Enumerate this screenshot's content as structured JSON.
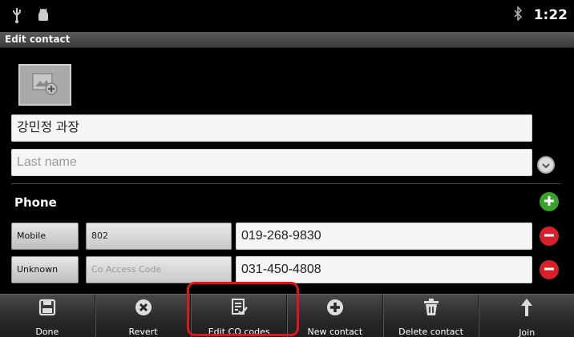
{
  "status_bar": {
    "icons": [
      "usb-icon",
      "android-debug-icon",
      "bluetooth-icon"
    ],
    "time": "1:22"
  },
  "title": "Edit contact",
  "photo": {
    "icon": "add-photo-icon"
  },
  "name": {
    "first_value": "강민정 과장",
    "last_placeholder": "Last name"
  },
  "phone": {
    "section_title": "Phone",
    "rows": [
      {
        "type": "Mobile",
        "code": "802",
        "code_is_placeholder": false,
        "number": "019-268-9830"
      },
      {
        "type": "Unknown",
        "code": "Co Access Code",
        "code_is_placeholder": true,
        "number": "031-450-4808"
      }
    ]
  },
  "toolbar": {
    "done": "Done",
    "revert": "Revert",
    "edit_co_codes": "Edit CO codes",
    "new_contact": "New contact",
    "delete_contact": "Delete contact",
    "join": "Join"
  },
  "colors": {
    "add": "#3aa02e",
    "remove": "#d8202a",
    "highlight": "#e0141e"
  }
}
